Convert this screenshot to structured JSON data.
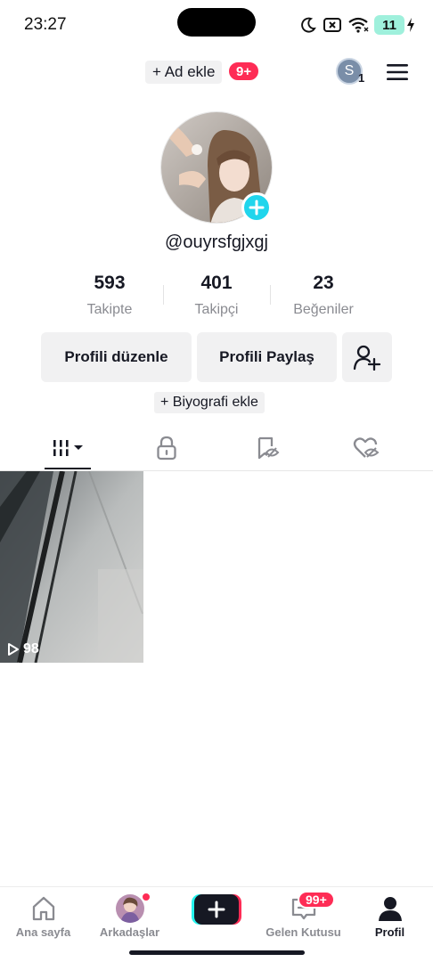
{
  "status_bar": {
    "time": "23:27",
    "battery_level": "11",
    "icons": [
      "moon-icon",
      "sim-off-icon",
      "wifi-icon",
      "charging-icon"
    ]
  },
  "top_bar": {
    "add_name_label": "+ Ad ekle",
    "notification_badge": "9+",
    "account_initial": "S",
    "account_count": "1"
  },
  "profile": {
    "username": "@ouyrsfgjxgj",
    "stats": [
      {
        "value": "593",
        "label": "Takipte"
      },
      {
        "value": "401",
        "label": "Takipçi"
      },
      {
        "value": "23",
        "label": "Beğeniler"
      }
    ],
    "edit_profile_label": "Profili düzenle",
    "share_profile_label": "Profili Paylaş",
    "add_bio_label": "+ Biyografi ekle"
  },
  "tabs": [
    {
      "name": "videos",
      "icon": "grid-bars-icon",
      "active": true
    },
    {
      "name": "private",
      "icon": "lock-icon",
      "active": false
    },
    {
      "name": "saved",
      "icon": "bookmark-eye-icon",
      "active": false
    },
    {
      "name": "liked",
      "icon": "heart-eye-icon",
      "active": false
    }
  ],
  "videos": [
    {
      "views": "98"
    }
  ],
  "bottom_nav": {
    "home_label": "Ana sayfa",
    "friends_label": "Arkadaşlar",
    "inbox_label": "Gelen Kutusu",
    "inbox_badge": "99+",
    "profile_label": "Profil"
  },
  "colors": {
    "accent": "#fe2c55",
    "cyan": "#20d5ec",
    "text": "#161823",
    "muted": "#8a8b91"
  }
}
